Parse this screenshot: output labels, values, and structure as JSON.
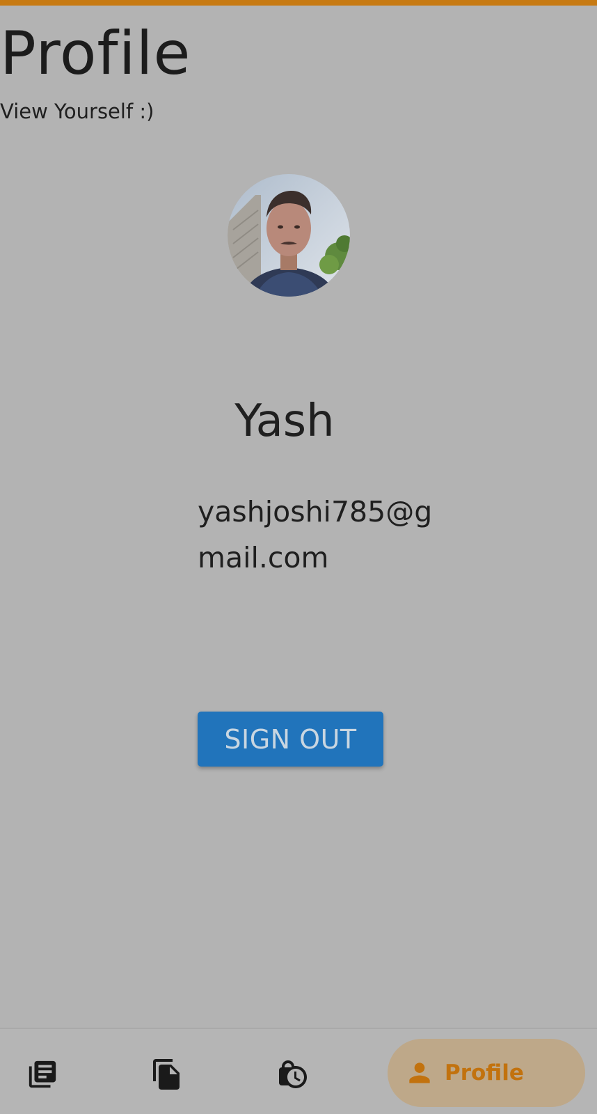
{
  "header": {
    "title": "Profile",
    "subtitle": "View Yourself :)"
  },
  "profile": {
    "name": "Yash",
    "email": "yashjoshi785@gmail.com",
    "avatar_alt": "profile-photo"
  },
  "actions": {
    "sign_out_label": "SIGN OUT"
  },
  "bottom_nav": {
    "items": [
      {
        "icon": "library-books-icon",
        "label": ""
      },
      {
        "icon": "file-copy-icon",
        "label": ""
      },
      {
        "icon": "lock-clock-icon",
        "label": ""
      },
      {
        "icon": "person-icon",
        "label": "Profile",
        "active": true
      }
    ]
  },
  "colors": {
    "accent": "#c77a12",
    "button": "#2174bb",
    "background": "#b3b3b3",
    "active_pill": "#bea889",
    "active_label": "#c2720e"
  }
}
